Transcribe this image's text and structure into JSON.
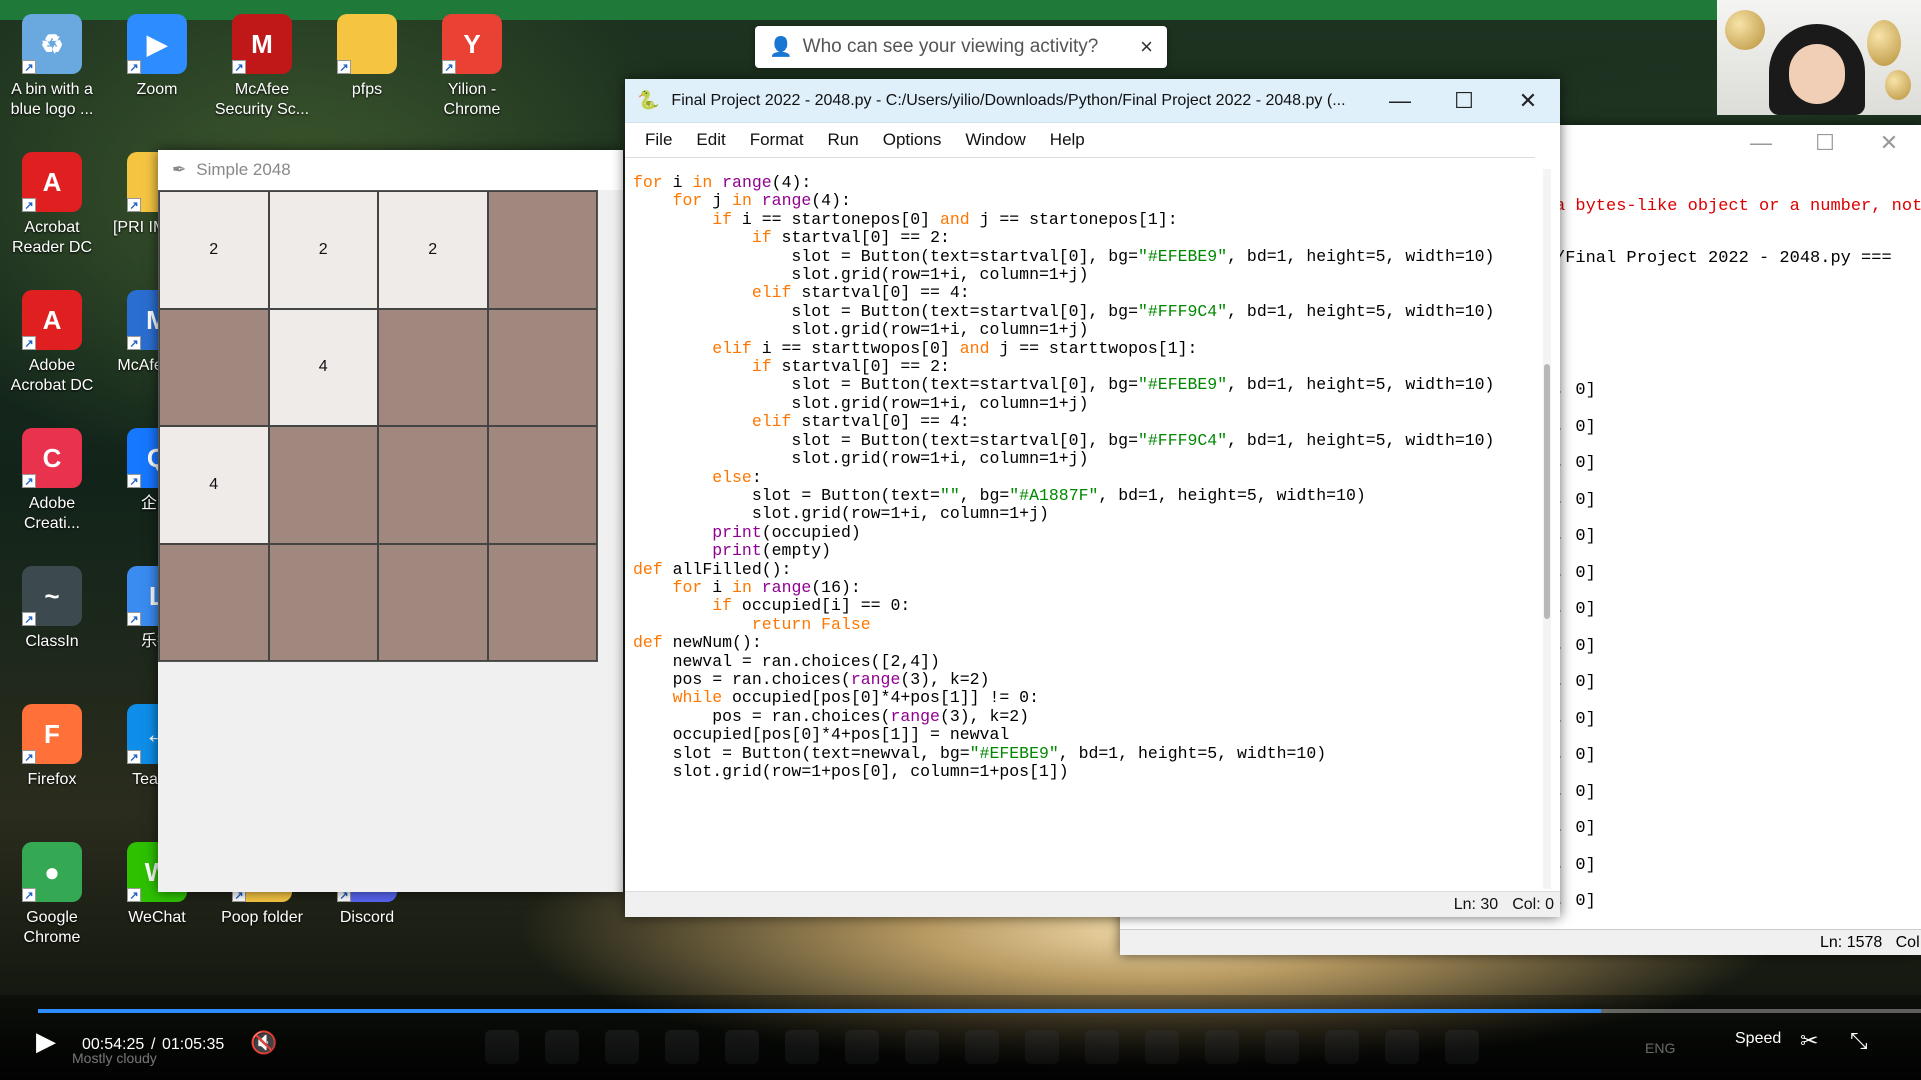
{
  "desktop": {
    "icons": [
      {
        "name": "recycle-bin",
        "label": "A bin with a blue logo ...",
        "color": "#6aa8e0",
        "glyph": "♻"
      },
      {
        "name": "zoom",
        "label": "Zoom",
        "color": "#2d8cff",
        "glyph": "▶"
      },
      {
        "name": "mcafee-security",
        "label": "McAfee Security Sc...",
        "color": "#c01818",
        "glyph": "M"
      },
      {
        "name": "pfps-folder",
        "label": "pfps",
        "color": "#f5c542",
        "glyph": ""
      },
      {
        "name": "yilion-chrome",
        "label": "Yilion - Chrome",
        "color": "#e94235",
        "glyph": "Y"
      },
      {
        "name": "acrobat-reader",
        "label": "Acrobat Reader DC",
        "color": "#e02020",
        "glyph": "A"
      },
      {
        "name": "pri-impor",
        "label": "[PRI IMPOR",
        "color": "#f5c542",
        "glyph": ""
      },
      {
        "name": "adobe-acrobat",
        "label": "Adobe Acrobat DC",
        "color": "#e02020",
        "glyph": "A"
      },
      {
        "name": "mcafee-con",
        "label": "McAfe Con",
        "color": "#2b6ed1",
        "glyph": "M"
      },
      {
        "name": "adobe-creative",
        "label": "Adobe Creati...",
        "color": "#e8324e",
        "glyph": "C"
      },
      {
        "name": "qiye",
        "label": "企业",
        "color": "#1677ff",
        "glyph": "Q"
      },
      {
        "name": "classin",
        "label": "ClassIn",
        "color": "#3c4a50",
        "glyph": "~"
      },
      {
        "name": "lebo",
        "label": "乐播",
        "color": "#3a8cf0",
        "glyph": "L"
      },
      {
        "name": "firefox",
        "label": "Firefox",
        "color": "#ff7139",
        "glyph": "F"
      },
      {
        "name": "teamviewer",
        "label": "TeamV",
        "color": "#0e8ee9",
        "glyph": "↔"
      },
      {
        "name": "google-chrome",
        "label": "Google Chrome",
        "color": "#34a853",
        "glyph": "●"
      },
      {
        "name": "wechat",
        "label": "WeChat",
        "color": "#2dc100",
        "glyph": "W"
      },
      {
        "name": "poop-folder",
        "label": "Poop folder",
        "color": "#f5c542",
        "glyph": ""
      },
      {
        "name": "discord",
        "label": "Discord",
        "color": "#5865f2",
        "glyph": "D"
      }
    ]
  },
  "tooltip": {
    "text": "Who can see your viewing activity?",
    "close": "×"
  },
  "simple2048": {
    "title": "Simple 2048",
    "cells": [
      "2",
      "2",
      "2",
      "",
      "",
      "4",
      "",
      "",
      "4",
      "",
      "",
      "",
      "",
      "",
      "",
      ""
    ],
    "colors": {
      "empty": "#A1887F",
      "two": "#EFEBE9",
      "four": "#FFF9C4"
    }
  },
  "idle": {
    "title": "Final Project 2022 - 2048.py - C:/Users/yilio/Downloads/Python/Final Project 2022 - 2048.py (...",
    "menu": [
      "File",
      "Edit",
      "Format",
      "Run",
      "Options",
      "Window",
      "Help"
    ],
    "status_ln": "Ln: 30",
    "status_col": "Col: 0",
    "code": [
      "for i in range(4):",
      "    for j in range(4):",
      "        if i == startonepos[0] and j == startonepos[1]:",
      "            if startval[0] == 2:",
      "                slot = Button(text=startval[0], bg=\"#EFEBE9\", bd=1, height=5, width=10)",
      "                slot.grid(row=1+i, column=1+j)",
      "",
      "            elif startval[0] == 4:",
      "                slot = Button(text=startval[0], bg=\"#FFF9C4\", bd=1, height=5, width=10)",
      "                slot.grid(row=1+i, column=1+j)",
      "        elif i == starttwopos[0] and j == starttwopos[1]:",
      "            if startval[0] == 2:",
      "                slot = Button(text=startval[0], bg=\"#EFEBE9\", bd=1, height=5, width=10)",
      "                slot.grid(row=1+i, column=1+j)",
      "            elif startval[0] == 4:",
      "                slot = Button(text=startval[0], bg=\"#FFF9C4\", bd=1, height=5, width=10)",
      "                slot.grid(row=1+i, column=1+j)",
      "        else:",
      "            slot = Button(text=\"\", bg=\"#A1887F\", bd=1, height=5, width=10)",
      "            slot.grid(row=1+i, column=1+j)",
      "",
      "        print(occupied)",
      "        print(empty)",
      "",
      "",
      "def allFilled():",
      "    for i in range(16):",
      "        if occupied[i] == 0:",
      "            return False",
      "",
      "",
      "def newNum():",
      "    newval = ran.choices([2,4])",
      "    pos = ran.choices(range(3), k=2)",
      "    while occupied[pos[0]*4+pos[1]] != 0:",
      "        pos = ran.choices(range(3), k=2)",
      "    occupied[pos[0]*4+pos[1]] = newval",
      "    slot = Button(text=newval, bg=\"#EFEBE9\", bd=1, height=5, width=10)",
      "    slot.grid(row=1+pos[0], column=1+pos[1])"
    ]
  },
  "shell": {
    "error": "a bytes-like object or a number, not",
    "restart": "/Final Project 2022 - 2048.py ===",
    "lines": [
      ", 0]",
      ", 0]",
      ", 0]",
      ", 0]",
      ", 0]",
      ", 0]",
      ", 0]",
      ", 0]",
      ", 0]",
      ", 0]",
      ", 0]",
      ", 0]",
      ", 0]",
      ", 0]",
      ", 0]",
      ", 0]"
    ],
    "status_ln": "Ln: 1578",
    "status_col": "Col"
  },
  "player": {
    "current": "00:54:25",
    "separator": "/",
    "total": "01:05:35",
    "progress": 0.83,
    "speed": "Speed",
    "weather": "Mostly cloudy",
    "lang": "ENG"
  }
}
